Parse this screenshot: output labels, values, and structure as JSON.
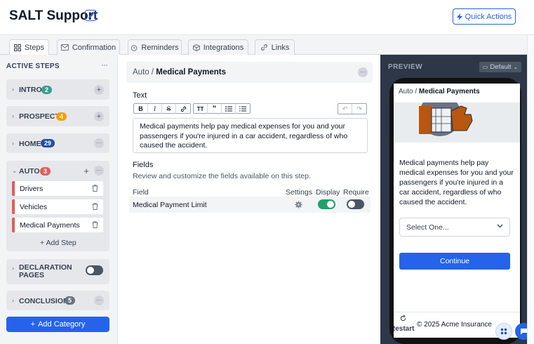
{
  "header": {
    "title": "SALT Support",
    "quick_actions": "Quick Actions"
  },
  "tabs": [
    {
      "label": "Steps",
      "icon": "grid-icon"
    },
    {
      "label": "Confirmation",
      "icon": "mail-icon"
    },
    {
      "label": "Reminders",
      "icon": "alarm-icon"
    },
    {
      "label": "Integrations",
      "icon": "cube-icon"
    },
    {
      "label": "Links",
      "icon": "link-icon"
    }
  ],
  "sidebar": {
    "title": "ACTIVE STEPS",
    "categories": [
      {
        "label": "INTRO",
        "count": "2",
        "badge_color": "#3b9e8f"
      },
      {
        "label": "PROSPECT",
        "count": "4",
        "badge_color": "#f59e0b"
      },
      {
        "label": "HOME",
        "count": "29",
        "badge_color": "#1e4fa8"
      },
      {
        "label": "AUTO",
        "count": "3",
        "badge_color": "#e05d5d"
      },
      {
        "label": "DECLARATION PAGES"
      },
      {
        "label": "CONCLUSION",
        "count": "5",
        "badge_color": "#6b7280"
      }
    ],
    "auto_steps": [
      "Drivers",
      "Vehicles",
      "Medical Payments"
    ],
    "add_step": "+ Add Step",
    "add_category": "Add Category"
  },
  "editor": {
    "crumb_parent": "Auto /",
    "crumb_current": "Medical Payments",
    "text_label": "Text",
    "body": "Medical payments help pay medical expenses for you and your passengers if you're injured in a car accident, regardless of who caused the accident.",
    "fields_label": "Fields",
    "fields_desc": "Review and customize the fields available on this step.",
    "col_field": "Field",
    "col_settings": "Settings",
    "col_display": "Display",
    "col_require": "Require",
    "row_field": "Medical Payment Limit",
    "display_on": true,
    "require_on": false
  },
  "preview": {
    "title": "PREVIEW",
    "device": "Default",
    "crumb_parent": "Auto /",
    "crumb_current": "Medical Payments",
    "body": "Medical payments help pay medical expenses for you and your passengers if you're injured in a car accident, regardless of who caused the accident.",
    "select_placeholder": "Select One...",
    "continue": "Continue",
    "restart": "Restart",
    "copyright": "© 2025 Acme Insurance"
  },
  "colors": {
    "accent": "#2563eb",
    "toggle_on": "#22a06b",
    "toggle_off": "#4b5563"
  }
}
